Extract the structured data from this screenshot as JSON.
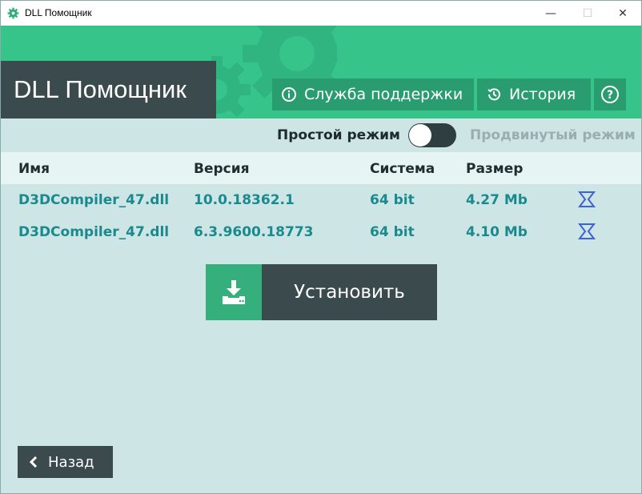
{
  "window": {
    "title": "DLL Помощник",
    "controls": {
      "minimize": "—",
      "maximize": "☐",
      "close": "✕"
    }
  },
  "header": {
    "app_title": "DLL Помощник",
    "support_label": "Служба поддержки",
    "history_label": "История",
    "help_label": "?",
    "colors": {
      "band": "#36c48a",
      "button": "#2a9d70",
      "title_box": "#3b4a4d"
    }
  },
  "mode": {
    "simple_label": "Простой режим",
    "advanced_label": "Продвинутый режим",
    "selected": "simple"
  },
  "table": {
    "columns": [
      "Имя",
      "Версия",
      "Система",
      "Размер"
    ],
    "rows": [
      {
        "name": "D3DCompiler_47.dll",
        "version": "10.0.18362.1",
        "system": "64 bit",
        "size": "4.27 Mb",
        "action_icon": "sigma-arrow-icon"
      },
      {
        "name": "D3DCompiler_47.dll",
        "version": "6.3.9600.18773",
        "system": "64 bit",
        "size": "4.10 Mb",
        "action_icon": "sigma-arrow-icon"
      }
    ]
  },
  "install": {
    "label": "Установить",
    "icon": "download-tray-icon"
  },
  "back": {
    "label": "Назад",
    "icon": "chevron-left-icon"
  }
}
